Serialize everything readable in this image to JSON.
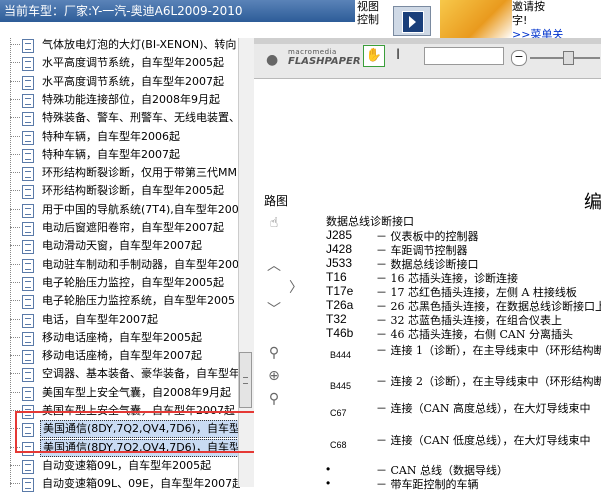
{
  "header": {
    "model_label": "当前车型：厂家:Y-一汽-奥迪A6L2009-2010",
    "view_control_line1": "视图",
    "view_control_line2": "控制",
    "ad_line1": "邀请按",
    "ad_line2": "字!",
    "ad_link": ">>菜单关"
  },
  "tree": {
    "items": [
      {
        "label": "气体放电灯泡的大灯(BI-XENON)、转向"
      },
      {
        "label": "水平高度调节系统，自车型年2005起"
      },
      {
        "label": "水平高度调节系统，自车型年2007起"
      },
      {
        "label": "特殊功能连接部位，自2008年9月起"
      },
      {
        "label": "特殊装备、警车、刑警车、无线电装置、"
      },
      {
        "label": "特种车辆，自车型年2006起"
      },
      {
        "label": "特种车辆，自车型年2007起"
      },
      {
        "label": "环形结构断裂诊断，仅用于带第三代MM"
      },
      {
        "label": "环形结构断裂诊断，自车型年2005起"
      },
      {
        "label": "用于中国的导航系统(7T4),自车型年200"
      },
      {
        "label": "电动后窗遮阳卷帘，自车型年2007起"
      },
      {
        "label": "电动滑动天窗，自车型年2007起"
      },
      {
        "label": "电动驻车制动和手制动器，自车型年2007"
      },
      {
        "label": "电子轮胎压力监控，自车型年2005起"
      },
      {
        "label": "电子轮胎压力监控系统，自车型年2005"
      },
      {
        "label": "电话，自车型年2007起"
      },
      {
        "label": "移动电话座椅，自车型年2005起"
      },
      {
        "label": "移动电话座椅，自车型年2007起"
      },
      {
        "label": "空调器、基本装备、豪华装备，自车型年"
      },
      {
        "label": "美国车型上安全气囊，自2008年9月起"
      },
      {
        "label": "美国车型上安全气囊，自车型年2007起"
      },
      {
        "label": "美国通信(8DY,7Q2,QV4,7D6)，自车型"
      },
      {
        "label": "美国通信(8DY,7Q2,QV4,7D6)，自车型"
      },
      {
        "label": "自动变速箱09L，自车型年2005起"
      },
      {
        "label": "自动变速箱09L、09E，自车型年2007起"
      }
    ]
  },
  "viewer": {
    "brand_small": "macromedia",
    "brand_big": "FLASHPAPER",
    "page_input_value": "",
    "zoom_minus": "−"
  },
  "document": {
    "title_fragment": "路图",
    "right_fragment": "编",
    "section_heading": "数据总线诊断接口",
    "rows": [
      {
        "code": "J285",
        "desc": "－ 仪表板中的控制器"
      },
      {
        "code": "J428",
        "desc": "－ 车距调节控制器"
      },
      {
        "code": "J533",
        "desc": "－ 数据总线诊断接口"
      },
      {
        "code": "T16",
        "desc": "－ 16 芯插头连接，诊断连接"
      },
      {
        "code": "T17e",
        "desc": "－ 17 芯红色插头连接，左侧 A 柱接线板"
      },
      {
        "code": "T26a",
        "desc": "－ 26 芯黑色插头连接，在数据总线诊断接口上"
      },
      {
        "code": "T32",
        "desc": "－ 32 芯蓝色插头连接，在组合仪表上"
      },
      {
        "code": "T46b",
        "desc": "－ 46 芯插头连接，右侧 CAN 分离插头"
      },
      {
        "code": "B444",
        "desc": "－ 连接 1（诊断），在主导线束中（环形结构断"
      },
      {
        "code": "B445",
        "desc": "－ 连接 2（诊断），在主导线束中（环形结构断"
      },
      {
        "code": "C67",
        "desc": "－ 连接（CAN 高度总线），在大灯导线束中"
      },
      {
        "code": "C68",
        "desc": "－ 连接（CAN 低度总线），在大灯导线束中"
      },
      {
        "code": "•",
        "desc": "－ CAN 总线（数据导线）"
      },
      {
        "code": "•",
        "desc": "－ 带车距控制的车辆"
      }
    ]
  },
  "colors": {
    "header_bg": "#3e6fae",
    "selection_bg": "#c9dbf3",
    "highlight_box": "#e53935"
  }
}
